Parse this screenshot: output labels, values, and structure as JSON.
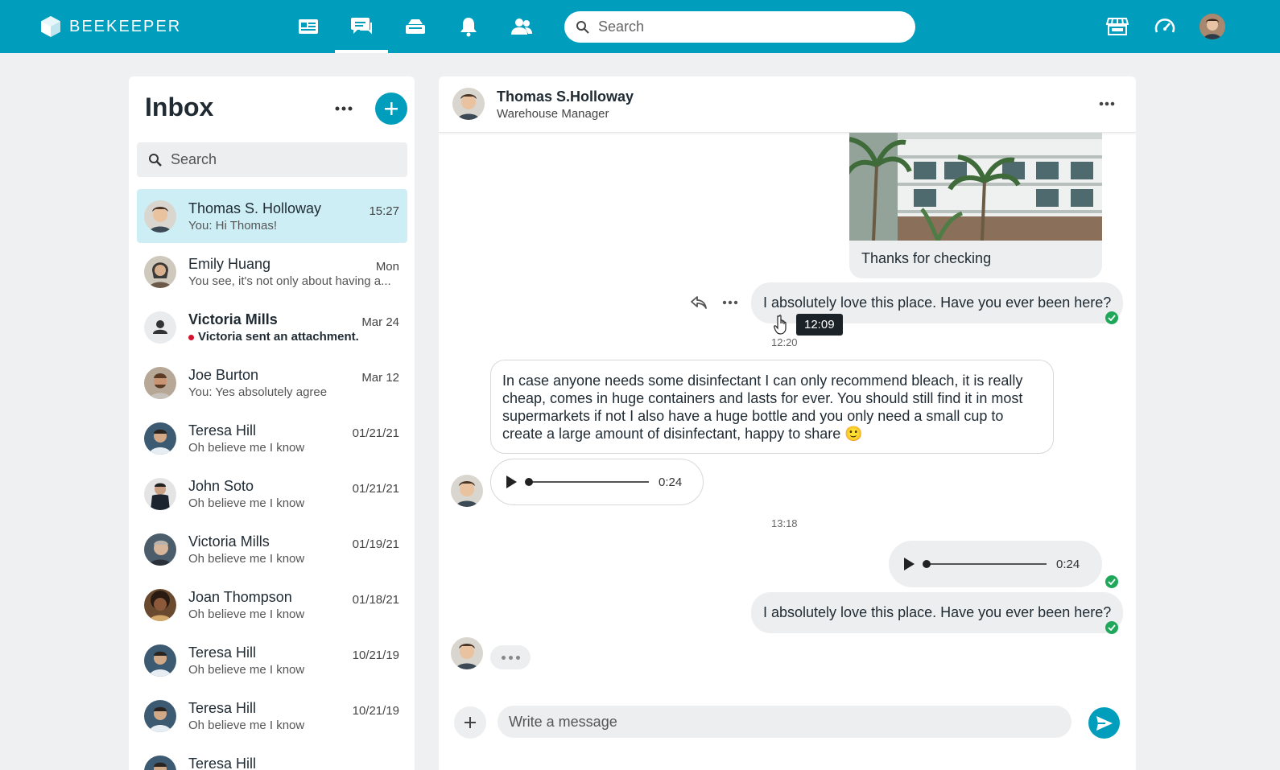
{
  "topbar": {
    "brand": "BEEKEEPER",
    "search_placeholder": "Search",
    "nav_icons": [
      "news-feed-icon",
      "chat-icon",
      "tools-icon",
      "notifications-icon",
      "people-icon"
    ],
    "active_nav": "chat-icon",
    "right_icons": [
      "shop-icon",
      "dashboard-icon"
    ],
    "accent": "#019dbd"
  },
  "inbox": {
    "title": "Inbox",
    "search_placeholder": "Search",
    "conversations": [
      {
        "name": "Thomas S. Holloway",
        "preview": "You: Hi Thomas!",
        "time": "15:27",
        "active": true
      },
      {
        "name": "Emily Huang",
        "preview": "You see, it's not only about having a...",
        "time": "Mon"
      },
      {
        "name": "Victoria Mills",
        "preview": "Victoria sent an attachment.",
        "time": "Mar 24",
        "unread": true
      },
      {
        "name": "Joe Burton",
        "preview": "You: Yes absolutely agree",
        "time": "Mar 12"
      },
      {
        "name": "Teresa Hill",
        "preview": "Oh believe me I know",
        "time": "01/21/21"
      },
      {
        "name": "John Soto",
        "preview": "Oh believe me I know",
        "time": "01/21/21"
      },
      {
        "name": "Victoria Mills",
        "preview": "Oh believe me I know",
        "time": "01/19/21"
      },
      {
        "name": "Joan Thompson",
        "preview": "Oh believe me I know",
        "time": "01/18/21"
      },
      {
        "name": "Teresa Hill",
        "preview": "Oh believe me I know",
        "time": "10/21/19"
      },
      {
        "name": "Teresa Hill",
        "preview": "Oh believe me I know",
        "time": "10/21/19"
      },
      {
        "name": "Teresa Hill",
        "preview": "",
        "time": ""
      }
    ]
  },
  "chat": {
    "contact_name": "Thomas S.Holloway",
    "contact_role": "Warehouse Manager",
    "image_caption": "Thanks for checking",
    "msg_love_1": "I absolutely love this place. Have you ever been here?",
    "tooltip_time": "12:09",
    "ts_1220": "12:20",
    "long_message": "In case anyone needs some disinfectant I can only recommend bleach, it is really cheap, comes in huge containers and lasts for ever. You should still find it in most supermarkets  if not I also have a huge bottle and you only need a small cup to create a large amount of disinfectant, happy to share 🙂",
    "audio_in_duration": "0:24",
    "ts_1318": "13:18",
    "audio_out_duration": "0:24",
    "msg_love_2": "I absolutely love this place. Have you ever been here?",
    "composer_placeholder": "Write a message",
    "read_status_color": "#1fa85a"
  }
}
